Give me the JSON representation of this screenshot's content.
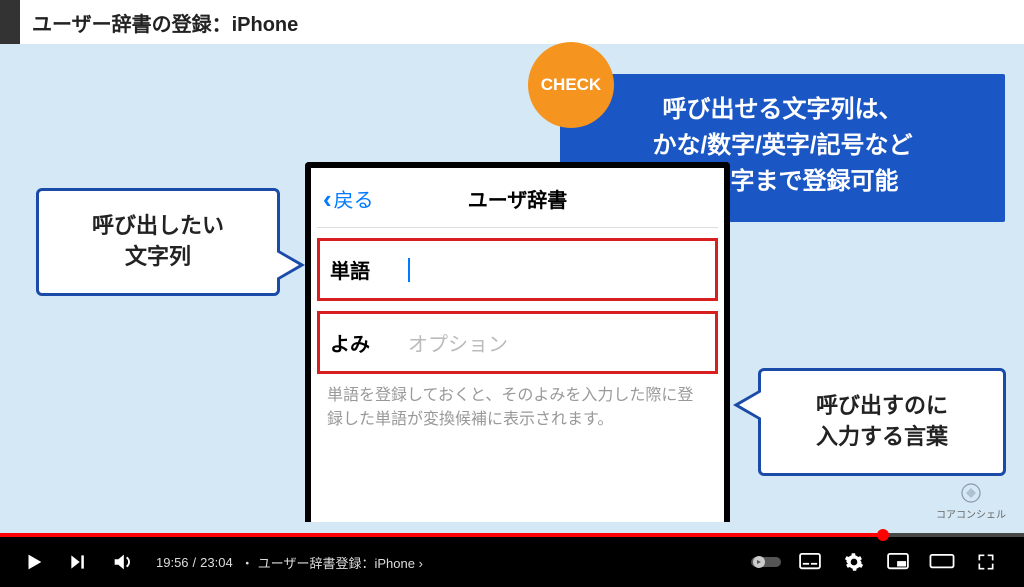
{
  "header": {
    "title": "ユーザー辞書の登録：iPhone"
  },
  "phone": {
    "back_label": "戻る",
    "nav_title": "ユーザ辞書",
    "field_word_label": "単語",
    "field_yomi_label": "よみ",
    "field_yomi_placeholder": "オプション",
    "help_text": "単語を登録しておくと、そのよみを入力した際に登録した単語が変換候補に表示されます。"
  },
  "callouts": {
    "left_text": "呼び出したい\n文字列",
    "right_text": "呼び出すのに\n入力する言葉",
    "check_label": "CHECK",
    "blue_panel": "呼び出せる文字列は、\nかな/数字/英字/記号など\n250文字まで登録可能"
  },
  "watermark": {
    "text": "コアコンシェル"
  },
  "player": {
    "current_time": "19:56",
    "duration": "23:04",
    "chapter_separator": "・",
    "chapter_title": "ユーザー辞書登録：iPhone",
    "progress_percent": 86.2
  }
}
